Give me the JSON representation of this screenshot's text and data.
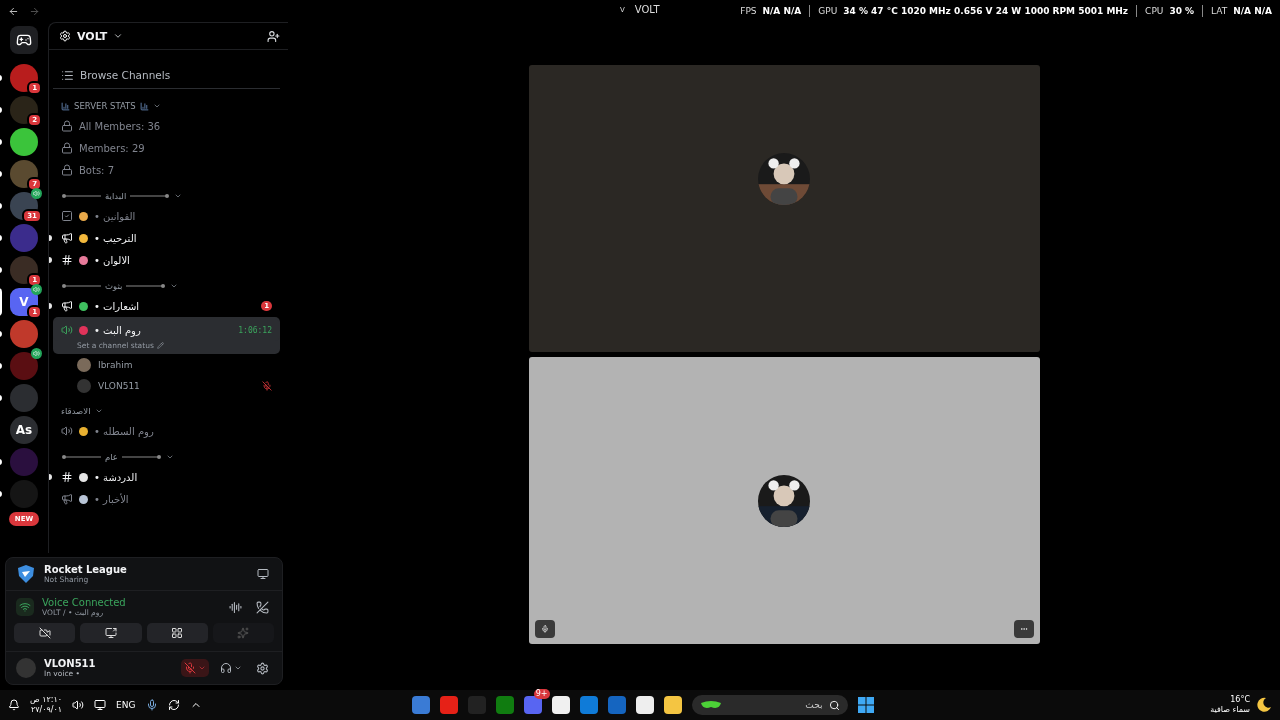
{
  "titlebar": {
    "server_initial": "V",
    "title": "VOLT"
  },
  "overlay": {
    "fps": {
      "label": "FPS",
      "value": "N/A N/A"
    },
    "gpu": {
      "label": "GPU",
      "value": "34 % 47 °C 1020 MHz 0.656 V 24 W 1000 RPM 5001 MHz"
    },
    "cpu": {
      "label": "CPU",
      "value": "30 %"
    },
    "lat": {
      "label": "LAT",
      "value": "N/A N/A"
    }
  },
  "servers": [
    {
      "color": "#b81d1d",
      "unread": true,
      "badge": "1",
      "selected": false
    },
    {
      "color": "#2a2418",
      "unread": true,
      "badge": "2",
      "selected": false
    },
    {
      "color": "#3bc43b",
      "unread": true,
      "selected": false
    },
    {
      "color": "#5a4a30",
      "unread": true,
      "badge": "7",
      "selected": false
    },
    {
      "color": "#3a4452",
      "unread": true,
      "badge": "31",
      "voice": true,
      "selected": false
    },
    {
      "color": "#3b2c8c",
      "unread": true,
      "selected": false
    },
    {
      "color": "#3a2c24",
      "unread": true,
      "badge": "1",
      "selected": false
    },
    {
      "color": "#5865f2",
      "label": "V",
      "badge": "1",
      "voice": true,
      "selected": true
    },
    {
      "color": "#c0392b",
      "unread": true,
      "selected": false
    },
    {
      "color": "#5a0e12",
      "unread": true,
      "voice": true,
      "selected": false
    },
    {
      "color": "#2b2d31",
      "unread": true,
      "selected": false
    },
    {
      "color": "#2b2d31",
      "label": "As",
      "unread": false,
      "selected": false
    },
    {
      "color": "#2a0f3e",
      "unread": true,
      "selected": false
    },
    {
      "color": "#151515",
      "unread": true,
      "selected": false
    }
  ],
  "new_badge": "NEW",
  "server": {
    "name": "VOLT"
  },
  "browse": "Browse Channels",
  "channels": [
    {
      "kind": "category",
      "name": "SERVER STATS"
    },
    {
      "kind": "locked",
      "name": "All Members: 36",
      "unread": false,
      "selected": false
    },
    {
      "kind": "locked",
      "name": "Members: 29",
      "unread": false,
      "selected": false
    },
    {
      "kind": "locked",
      "name": "Bots: 7",
      "unread": false,
      "selected": false
    },
    {
      "kind": "lined-category",
      "name": "البداية"
    },
    {
      "kind": "rules",
      "color": "#e8a94a",
      "name": "القوانين •",
      "unread": false,
      "selected": false
    },
    {
      "kind": "announcement",
      "color": "#f2b83c",
      "name": "الترحيب •",
      "unread": true,
      "selected": false
    },
    {
      "kind": "text",
      "color": "#e77a9a",
      "name": "الالوان •",
      "unread": true,
      "selected": false
    },
    {
      "kind": "lined-category",
      "name": "بثوث"
    },
    {
      "kind": "announcement",
      "color": "#3fbf5f",
      "name": "اشعارات •",
      "unread": true,
      "badge": "1",
      "selected": false
    },
    {
      "kind": "voice",
      "color": "#e0335a",
      "name": "روم البث •",
      "unread": true,
      "selected": true,
      "timer": "1:06:12",
      "status": "Set a channel status",
      "children": [
        {
          "name": "Ibrahim",
          "muted": false
        },
        {
          "name": "VLON511",
          "muted": true
        }
      ]
    },
    {
      "kind": "category",
      "name": "الاصدقاء"
    },
    {
      "kind": "voice",
      "color": "#e8b030",
      "name": "روم السطله •",
      "unread": false,
      "selected": false
    },
    {
      "kind": "lined-category",
      "name": "عام"
    },
    {
      "kind": "text",
      "color": "#e6e6e6",
      "name": "الدردشة •",
      "unread": true,
      "selected": false
    },
    {
      "kind": "announcement",
      "color": "#b8c4d6",
      "name": "الأخبار •",
      "unread": false,
      "selected": false
    }
  ],
  "activity": {
    "game": "Rocket League",
    "sharing": "Not Sharing"
  },
  "voice": {
    "status": "Voice Connected",
    "channel": "روم البث • / VOLT"
  },
  "user": {
    "name": "VLON511",
    "status": "In voice •",
    "muted": true
  },
  "tiles": [
    {
      "color": "#2b2824"
    },
    {
      "color": "#b3b3b3"
    }
  ],
  "taskbar": {
    "time": "١٢:١٠ ص",
    "date": "٢٧/٠٩/٠١",
    "language": "ENG",
    "search": "بحث",
    "apps_badge": "9+",
    "temperature": "16°C",
    "weather": "سماء صافية"
  }
}
